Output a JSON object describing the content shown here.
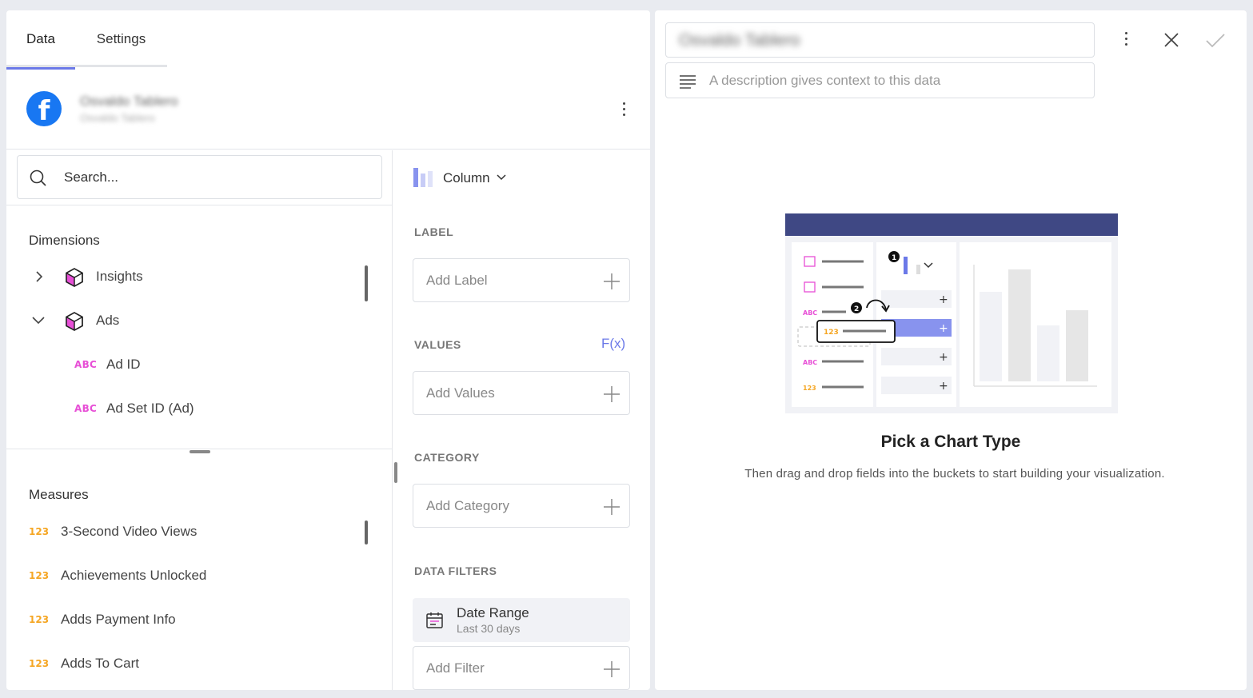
{
  "tabs": [
    {
      "label": "Data",
      "active": true
    },
    {
      "label": "Settings",
      "active": false
    }
  ],
  "source": {
    "name": "Osvaldo Tablero",
    "subtitle": "Osvaldo Tablero",
    "icon": "facebook-icon"
  },
  "search": {
    "placeholder": "Search..."
  },
  "dimensions": {
    "title": "Dimensions",
    "items": [
      {
        "label": "Insights",
        "type": "group",
        "expanded": false
      },
      {
        "label": "Ads",
        "type": "group",
        "expanded": true
      },
      {
        "label": "Ad ID",
        "type": "text",
        "badge": "ABC"
      },
      {
        "label": "Ad Set ID (Ad)",
        "type": "text",
        "badge": "ABC"
      }
    ]
  },
  "measures": {
    "title": "Measures",
    "items": [
      {
        "label": "3-Second Video Views",
        "badge": "123"
      },
      {
        "label": "Achievements Unlocked",
        "badge": "123"
      },
      {
        "label": "Adds Payment Info",
        "badge": "123"
      },
      {
        "label": "Adds To Cart",
        "badge": "123"
      }
    ]
  },
  "visualization": {
    "selected": "Column"
  },
  "buckets": {
    "label": {
      "title": "LABEL",
      "placeholder": "Add Label"
    },
    "values": {
      "title": "VALUES",
      "placeholder": "Add Values",
      "fx": "F(x)"
    },
    "category": {
      "title": "CATEGORY",
      "placeholder": "Add Category"
    },
    "filters": {
      "title": "DATA FILTERS",
      "chips": [
        {
          "label": "Date Range",
          "value": "Last 30 days"
        }
      ],
      "placeholder": "Add Filter"
    }
  },
  "editor": {
    "title": "Osvaldo Tablero",
    "description_placeholder": "A description gives context to this data"
  },
  "empty_state": {
    "title": "Pick a Chart Type",
    "subtitle": "Then drag and drop fields into the buckets to start building your visualization.",
    "illustration": {
      "badge_text": "ABC",
      "num_text": "123",
      "step_1": "1",
      "step_2": "2"
    }
  },
  "colors": {
    "accent": "#6b79e8",
    "text_badge": "#e74fd6",
    "number_badge": "#f5a623",
    "facebook": "#1877f2",
    "illustration_header": "#3f4884"
  }
}
